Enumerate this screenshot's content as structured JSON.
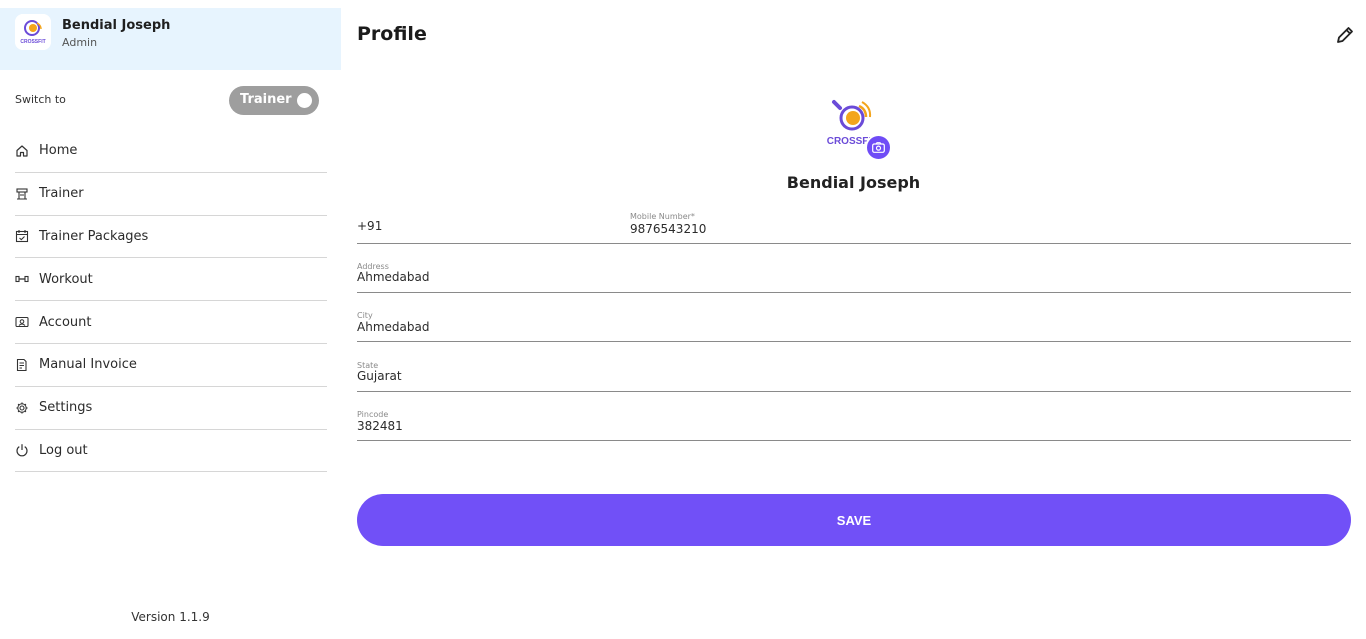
{
  "user": {
    "name": "Bendial Joseph",
    "role": "Admin",
    "logo_text": "CROSSFIT"
  },
  "switch": {
    "label": "Switch to",
    "toggle_text": "Trainer"
  },
  "nav": {
    "items": [
      {
        "label": "Home",
        "icon": "home-icon"
      },
      {
        "label": "Trainer",
        "icon": "trainer-icon"
      },
      {
        "label": "Trainer Packages",
        "icon": "calendar-check-icon"
      },
      {
        "label": "Workout",
        "icon": "dumbbell-icon"
      },
      {
        "label": "Account",
        "icon": "account-icon"
      },
      {
        "label": "Manual Invoice",
        "icon": "invoice-icon"
      },
      {
        "label": "Settings",
        "icon": "gear-icon"
      },
      {
        "label": "Log out",
        "icon": "power-icon"
      }
    ]
  },
  "version": "Version 1.1.9",
  "main": {
    "title": "Profile",
    "profile_name": "Bendial Joseph",
    "phone": {
      "country_code": "+91",
      "label": "Mobile Number*",
      "value": "9876543210"
    },
    "fields": {
      "address": {
        "label": "Address",
        "value": "Ahmedabad"
      },
      "city": {
        "label": "City",
        "value": "Ahmedabad"
      },
      "state": {
        "label": "State",
        "value": "Gujarat"
      },
      "pincode": {
        "label": "Pincode",
        "value": "382481"
      }
    },
    "save_label": "SAVE"
  },
  "colors": {
    "accent": "#7150f7",
    "user_card_bg": "#e7f4fe",
    "toggle_bg": "#9e9e9e"
  }
}
